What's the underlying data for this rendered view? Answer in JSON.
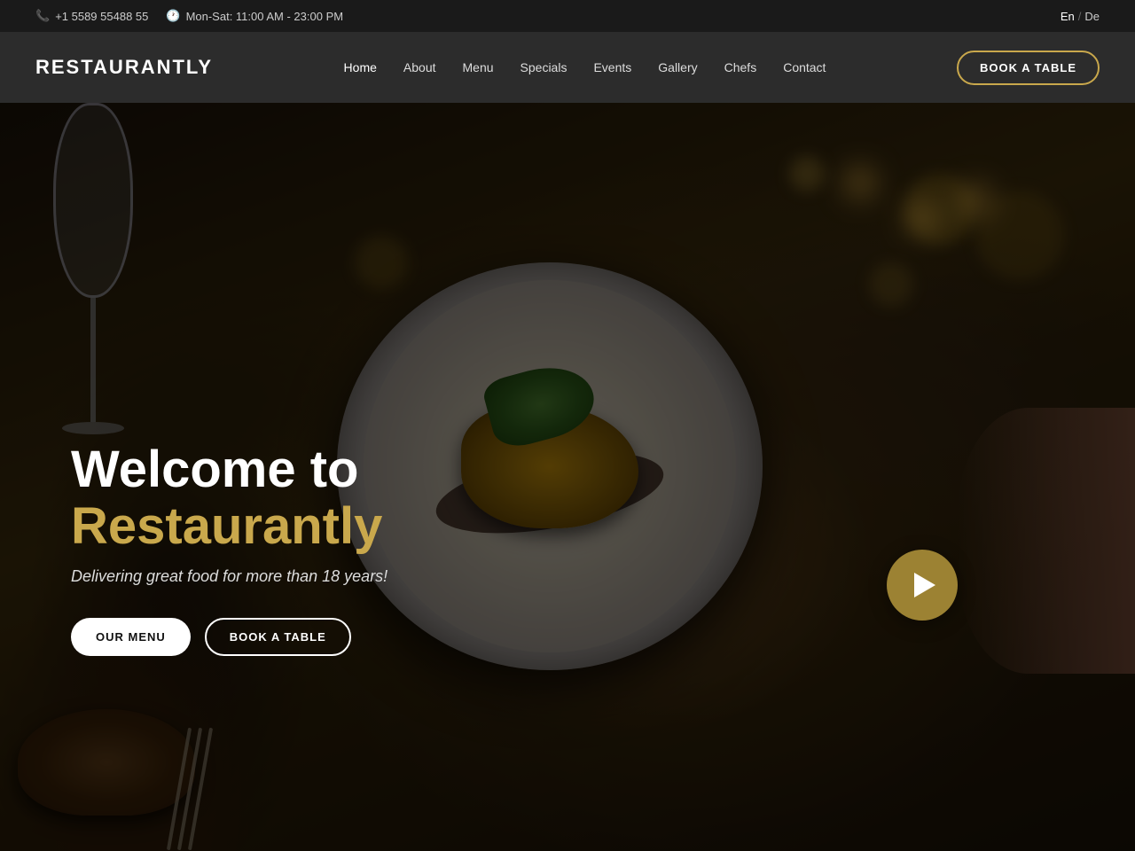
{
  "topbar": {
    "phone": "+1 5589 55488 55",
    "hours": "Mon-Sat: 11:00 AM - 23:00 PM",
    "lang_en": "En",
    "lang_sep": "/",
    "lang_de": "De"
  },
  "navbar": {
    "brand": "RESTAURANTLY",
    "links": [
      {
        "label": "Home",
        "active": true
      },
      {
        "label": "About",
        "active": false
      },
      {
        "label": "Menu",
        "active": false
      },
      {
        "label": "Specials",
        "active": false
      },
      {
        "label": "Events",
        "active": false
      },
      {
        "label": "Gallery",
        "active": false
      },
      {
        "label": "Chefs",
        "active": false
      },
      {
        "label": "Contact",
        "active": false
      }
    ],
    "book_btn": "BOOK A TABLE"
  },
  "hero": {
    "welcome_prefix": "Welcome to ",
    "brand_name": "Restaurantly",
    "subtitle": "Delivering great food for more than 18 years!",
    "btn_menu": "OUR MENU",
    "btn_book": "BOOK A TABLE"
  }
}
